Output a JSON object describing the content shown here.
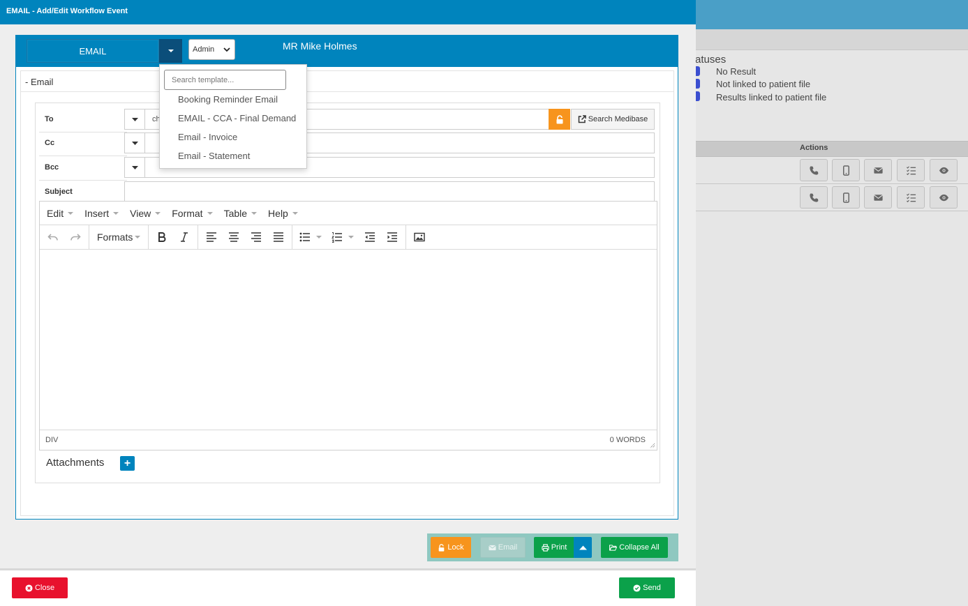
{
  "modal": {
    "title": "EMAIL - Add/Edit Workflow Event",
    "event_type": "EMAIL",
    "user_select": "Admin",
    "patient_name": "MR Mike Holmes",
    "section_title": "- Email"
  },
  "fields": {
    "to_label": "To",
    "to_value": "ch",
    "cc_label": "Cc",
    "bcc_label": "Bcc",
    "subject_label": "Subject",
    "search_medibase": "Search Medibase"
  },
  "editor": {
    "menus": [
      "Edit",
      "Insert",
      "View",
      "Format",
      "Table",
      "Help"
    ],
    "formats_label": "Formats",
    "status_path": "DIV",
    "word_count": "0 WORDS"
  },
  "attachments_label": "Attachments",
  "template_dropdown": {
    "search_placeholder": "Search template...",
    "items": [
      "Booking Reminder Email",
      "EMAIL - CCA - Final Demand",
      "Email - Invoice",
      "Email - Statement"
    ]
  },
  "actions": {
    "lock": "Lock",
    "email": "Email",
    "print": "Print",
    "collapse_all": "Collapse All",
    "close": "Close",
    "send": "Send"
  },
  "background": {
    "statuses_title": "atuses",
    "statuses": [
      "No Result",
      "Not linked to patient file",
      "Results linked to patient file"
    ],
    "actions_header": "Actions"
  },
  "colors": {
    "primary": "#0084bd",
    "success": "#0ba14a",
    "warning": "#f7941d",
    "danger": "#e8112d",
    "status_indicator": "#3b4fd0"
  }
}
